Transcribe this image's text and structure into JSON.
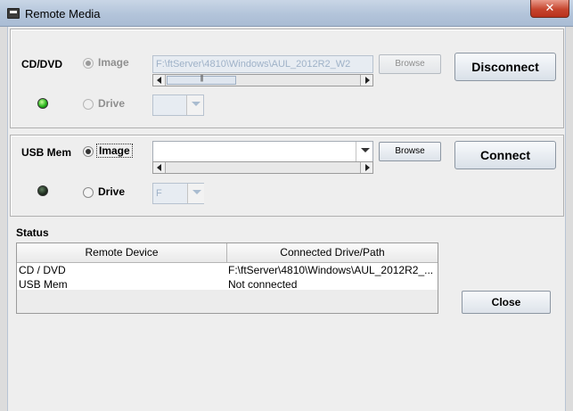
{
  "window": {
    "title": "Remote Media",
    "close_glyph": "✕"
  },
  "cd": {
    "section_label": "CD/DVD",
    "image_label": "Image",
    "drive_label": "Drive",
    "image_path": "F:\\ftServer\\4810\\Windows\\AUL_2012R2_W2",
    "browse_label": "Browse",
    "connect_button": "Disconnect",
    "status_led": "green-on"
  },
  "usb": {
    "section_label": "USB Mem",
    "image_label": "Image",
    "drive_label": "Drive",
    "image_path": "",
    "drive_value": "F",
    "browse_label": "Browse",
    "connect_button": "Connect",
    "status_led": "off"
  },
  "status": {
    "heading": "Status",
    "columns": [
      "Remote Device",
      "Connected Drive/Path"
    ],
    "rows": [
      {
        "device": "CD / DVD",
        "path": "F:\\ftServer\\4810\\Windows\\AUL_2012R2_..."
      },
      {
        "device": "USB Mem",
        "path": "Not connected"
      }
    ]
  },
  "close_button": "Close"
}
